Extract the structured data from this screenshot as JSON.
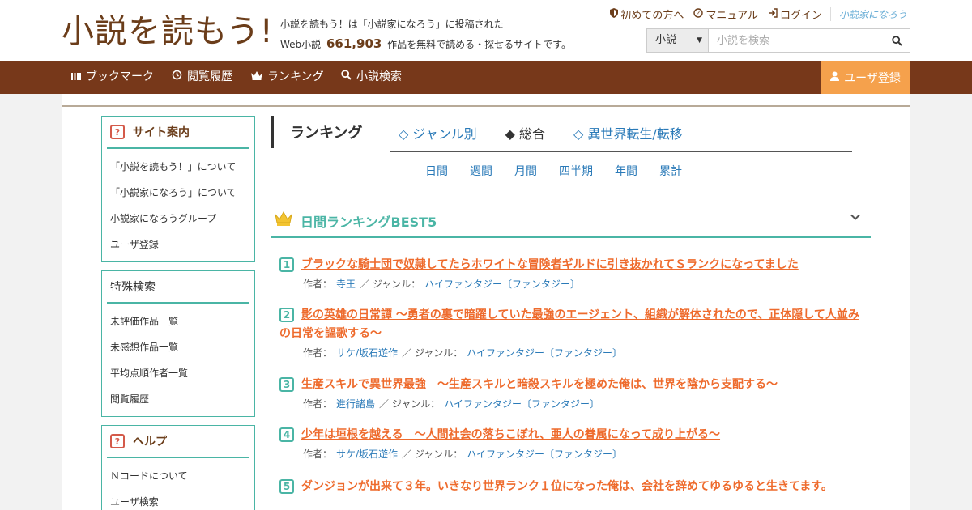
{
  "header": {
    "logo_text": "小説を読もう!",
    "tagline_line1": "小説を読もう！は「小説家になろう」に投稿された",
    "tagline_prefix": "Web小説",
    "work_count": "661,903",
    "tagline_suffix": "作品を無料で読める・探せるサイトです。",
    "links": [
      {
        "label": "初めての方へ",
        "icon": "shield-icon"
      },
      {
        "label": "マニュアル",
        "icon": "question-circle-icon"
      },
      {
        "label": "ログイン",
        "icon": "login-icon"
      }
    ],
    "narou_logo": "小説家になろう",
    "search": {
      "category": "小説",
      "placeholder": "小説を検索"
    }
  },
  "nav": {
    "items": [
      {
        "label": "ブックマーク",
        "icon": "bookmark-icon"
      },
      {
        "label": "閲覧履歴",
        "icon": "history-icon"
      },
      {
        "label": "ランキング",
        "icon": "crown-icon"
      },
      {
        "label": "小説検索",
        "icon": "search-icon"
      }
    ],
    "register": "ユーザ登録"
  },
  "sidebar": {
    "site_guide": {
      "title": "サイト案内",
      "items": [
        "「小説を読もう！」について",
        "「小説家になろう」について",
        "小説家になろうグループ",
        "ユーザ登録"
      ]
    },
    "special_search": {
      "title": "特殊検索",
      "items": [
        "未評価作品一覧",
        "未感想作品一覧",
        "平均点順作者一覧",
        "閲覧履歴"
      ]
    },
    "help": {
      "title": "ヘルプ",
      "items": [
        "Ｎコードについて",
        "ユーザ検索"
      ]
    }
  },
  "ranking": {
    "title": "ランキング",
    "tabs": [
      "◇ ジャンル別",
      "◆ 総合",
      "◇ 異世界転生/転移"
    ],
    "periods": [
      "日間",
      "週間",
      "月間",
      "四半期",
      "年間",
      "累計"
    ],
    "best_title": "日間ランキングBEST5",
    "author_label": "作者：",
    "genre_label": "／ ジャンル：",
    "entries": [
      {
        "rank": "1",
        "title": "ブラックな騎士団で奴隷してたらホワイトな冒険者ギルドに引き抜かれてＳランクになってました",
        "author": "寺王",
        "genre": "ハイファンタジー〔ファンタジー〕"
      },
      {
        "rank": "2",
        "title": "影の英雄の日常譚 ～勇者の裏で暗躍していた最強のエージェント、組織が解体されたので、正体隠して人並みの日常を謳歌する～",
        "author": "サケ/坂石遊作",
        "genre": "ハイファンタジー〔ファンタジー〕"
      },
      {
        "rank": "3",
        "title": "生産スキルで異世界最強　～生産スキルと暗殺スキルを極めた俺は、世界を陰から支配する～",
        "author": "進行諸島",
        "genre": "ハイファンタジー〔ファンタジー〕"
      },
      {
        "rank": "4",
        "title": "少年は垣根を越える　～人間社会の落ちこぼれ、亜人の眷属になって成り上がる～",
        "author": "サケ/坂石遊作",
        "genre": "ハイファンタジー〔ファンタジー〕"
      },
      {
        "rank": "5",
        "title": "ダンジョンが出来て３年。いきなり世界ランク１位になった俺は、会社を辞めてゆるゆると生きてます。",
        "author": "",
        "genre": ""
      }
    ]
  },
  "colors": {
    "brand_brown": "#77381a",
    "accent_orange": "#f5a14c",
    "teal": "#4ab5a5",
    "link_blue": "#2a7ab8",
    "title_orange": "#ee6b2d"
  }
}
